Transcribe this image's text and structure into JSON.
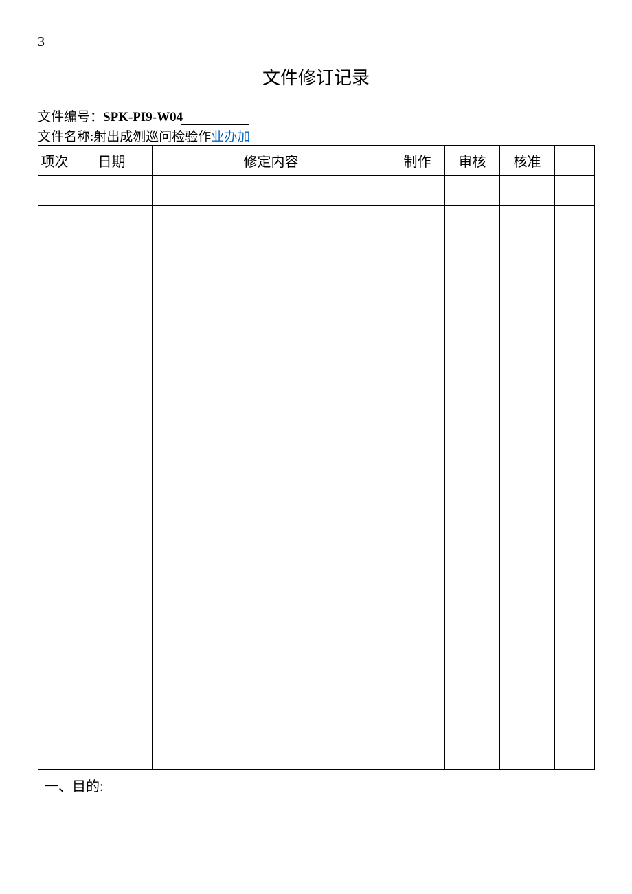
{
  "page_number": "3",
  "title": "文件修订记录",
  "doc_number": {
    "label": "文件编号：",
    "value": "SPK-PI9-W04"
  },
  "doc_name": {
    "label": "文件名称:",
    "value_underlined": "射出成刎巡问检验作",
    "value_link": "业办加"
  },
  "table_headers": {
    "item": "项次",
    "date": "日期",
    "content": "修定内容",
    "made": "制作",
    "review": "审核",
    "approve": "核准",
    "extra": ""
  },
  "rows": [
    {
      "item": "",
      "date": "",
      "content": "",
      "made": "",
      "review": "",
      "approve": "",
      "extra": ""
    },
    {
      "item": "",
      "date": "",
      "content": "",
      "made": "",
      "review": "",
      "approve": "",
      "extra": ""
    }
  ],
  "section_heading": "一、目的:"
}
